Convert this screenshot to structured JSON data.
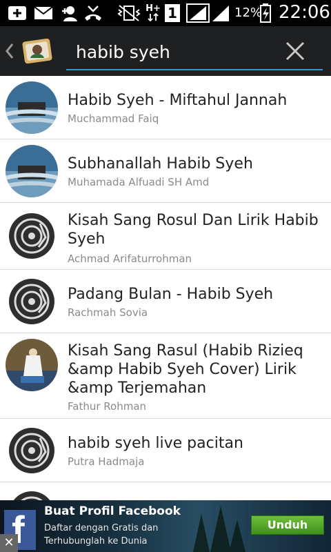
{
  "status_bar": {
    "battery_pct": "12%",
    "time": "22:06",
    "sim_label": "1",
    "network_label": "H+"
  },
  "action_bar": {
    "search_value": "habib syeh"
  },
  "results": [
    {
      "title": "Habib Syeh - Miftahul Jannah",
      "artist": "Muchammad Faiq",
      "thumb": "photo-mecca"
    },
    {
      "title": "Subhanallah Habib Syeh",
      "artist": "Muhamada Alfuadi SH Amd",
      "thumb": "photo-mecca"
    },
    {
      "title": "Kisah Sang Rosul Dan Lirik Habib Syeh",
      "artist": "Achmad Arifaturrohman",
      "thumb": "vinyl-icon"
    },
    {
      "title": "Padang Bulan - Habib Syeh",
      "artist": "Rachmah Sovia",
      "thumb": "vinyl-icon"
    },
    {
      "title": "Kisah Sang Rasul (Habib Rizieq &amp Habib Syeh Cover) Lirik &amp Terjemahan",
      "artist": "Fathur Rohman",
      "thumb": "photo-person"
    },
    {
      "title": "habib syeh live pacitan",
      "artist": "Putra Hadmaja",
      "thumb": "vinyl-icon"
    }
  ],
  "ad": {
    "logo_letter": "f",
    "title": "Buat Profil Facebook",
    "description": "Daftar dengan Gratis dan Terhubunglah ke Dunia",
    "button_label": "Unduh",
    "close_label": "✕"
  },
  "colors": {
    "accent": "#2a9bd0",
    "action_bar_bg": "#1f2021",
    "facebook_blue": "#3b5998",
    "ad_button_green": "#5aa82d"
  }
}
